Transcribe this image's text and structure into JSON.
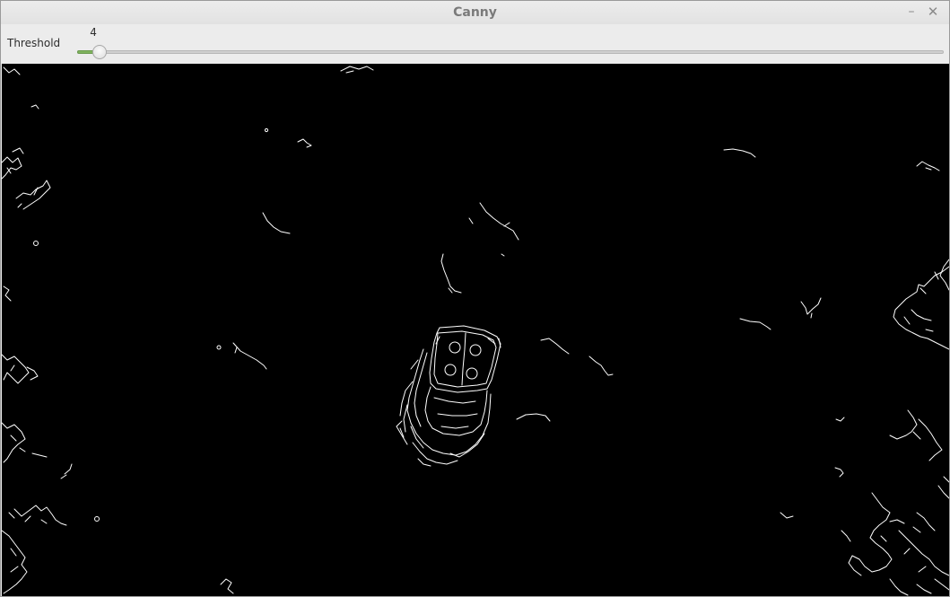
{
  "window": {
    "title": "Canny",
    "minimize_glyph": "–",
    "close_glyph": "✕"
  },
  "controls": {
    "threshold": {
      "label": "Threshold",
      "value": 4,
      "value_text": "4",
      "fill_fraction": 0.026
    }
  },
  "image": {
    "description_kind": "canny-edge-output",
    "background_color": "#000000",
    "edge_color": "#ffffff"
  }
}
